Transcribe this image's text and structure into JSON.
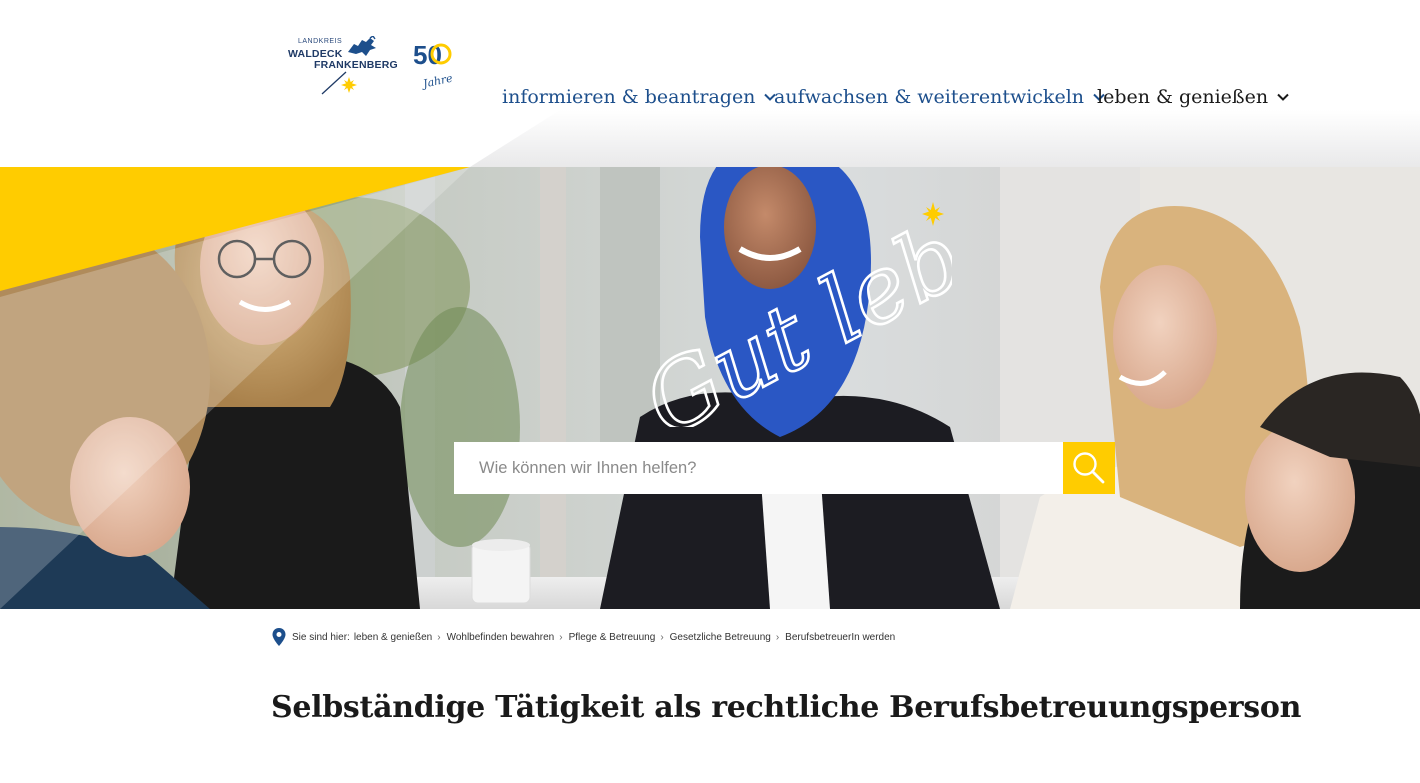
{
  "logo": {
    "line_small": "LANDKREIS",
    "line1": "WALDECK",
    "line2": "FRANKENBERG",
    "jubilee_number": "50",
    "jubilee_word": "Jahre"
  },
  "nav": {
    "items": [
      {
        "label": "informieren & beantragen",
        "icon": "chevron-down-icon"
      },
      {
        "label": "aufwachsen & weiterentwickeln",
        "icon": "chevron-down-icon"
      },
      {
        "label": "leben & genießen",
        "icon": "chevron-down-icon"
      }
    ]
  },
  "hero": {
    "script_text": "Gut leben",
    "search_placeholder": "Wie können wir Ihnen helfen?",
    "search_icon": "search-icon"
  },
  "breadcrumb": {
    "prefix": "Sie sind hier:",
    "items": [
      "leben & genießen",
      "Wohlbefinden bewahren",
      "Pflege & Betreuung",
      "Gesetzliche Betreuung",
      "BerufsbetreuerIn werden"
    ]
  },
  "page": {
    "title": "Selbständige Tätigkeit als rechtliche Berufsbetreuungsperson"
  },
  "colors": {
    "brand_blue": "#1d4f8c",
    "accent_yellow": "#ffcc00",
    "text_dark": "#1a1a1a"
  }
}
